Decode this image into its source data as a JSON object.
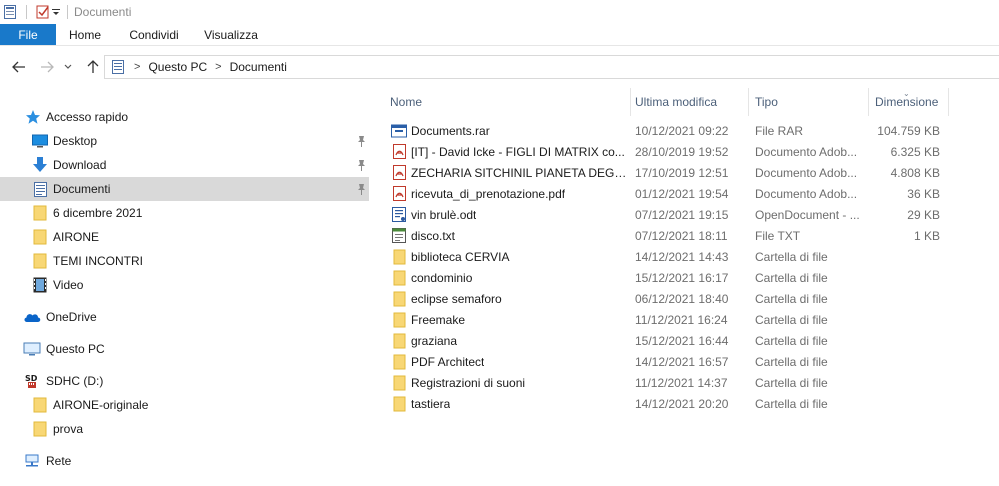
{
  "window": {
    "title": "Documenti"
  },
  "ribbon": {
    "tabs": [
      "File",
      "Home",
      "Condividi",
      "Visualizza"
    ]
  },
  "address": {
    "crumbs": [
      "Questo PC",
      "Documenti"
    ]
  },
  "sidebar": {
    "items": [
      {
        "label": "Accesso rapido",
        "icon": "star-icon",
        "indent": 1
      },
      {
        "label": "Desktop",
        "icon": "desktop-icon",
        "indent": 2,
        "pinned": true
      },
      {
        "label": "Download",
        "icon": "download-icon",
        "indent": 2,
        "pinned": true
      },
      {
        "label": "Documenti",
        "icon": "documents-icon",
        "indent": 2,
        "pinned": true,
        "selected": true
      },
      {
        "label": "6 dicembre 2021",
        "icon": "folder-icon",
        "indent": 2
      },
      {
        "label": "AIRONE",
        "icon": "folder-icon",
        "indent": 2
      },
      {
        "label": "TEMI INCONTRI",
        "icon": "folder-icon",
        "indent": 2
      },
      {
        "label": "Video",
        "icon": "video-icon",
        "indent": 2
      },
      {
        "label": "OneDrive",
        "icon": "cloud-icon",
        "indent": 1
      },
      {
        "label": "Questo PC",
        "icon": "computer-icon",
        "indent": 1
      },
      {
        "label": "SDHC (D:)",
        "icon": "sd-card-icon",
        "indent": 1
      },
      {
        "label": "AIRONE-originale",
        "icon": "folder-icon",
        "indent": 2
      },
      {
        "label": "prova",
        "icon": "folder-icon",
        "indent": 2
      },
      {
        "label": "Rete",
        "icon": "network-icon",
        "indent": 1
      }
    ]
  },
  "filelist": {
    "columns": {
      "name": "Nome",
      "date": "Ultima modifica",
      "type": "Tipo",
      "size": "Dimensione"
    },
    "rows": [
      {
        "name": "Documents.rar",
        "date": "10/12/2021 09:22",
        "type": "File RAR",
        "size": "104.759 KB",
        "icon": "archive-icon"
      },
      {
        "name": "[IT] - David Icke - FIGLI DI MATRIX co...",
        "date": "28/10/2019 19:52",
        "type": "Documento Adob...",
        "size": "6.325 KB",
        "icon": "pdf-icon"
      },
      {
        "name": "ZECHARIA SITCHINIL PIANETA DEGLI ...",
        "date": "17/10/2019 12:51",
        "type": "Documento Adob...",
        "size": "4.808 KB",
        "icon": "pdf-icon"
      },
      {
        "name": "ricevuta_di_prenotazione.pdf",
        "date": "01/12/2021 19:54",
        "type": "Documento Adob...",
        "size": "36 KB",
        "icon": "pdf-icon"
      },
      {
        "name": "vin brulè.odt",
        "date": "07/12/2021 19:15",
        "type": "OpenDocument - ...",
        "size": "29 KB",
        "icon": "odt-icon"
      },
      {
        "name": "disco.txt",
        "date": "07/12/2021 18:11",
        "type": "File TXT",
        "size": "1 KB",
        "icon": "text-file-icon"
      },
      {
        "name": "biblioteca CERVIA",
        "date": "14/12/2021 14:43",
        "type": "Cartella di file",
        "size": "",
        "icon": "folder-icon"
      },
      {
        "name": "condominio",
        "date": "15/12/2021 16:17",
        "type": "Cartella di file",
        "size": "",
        "icon": "folder-icon"
      },
      {
        "name": "eclipse semaforo",
        "date": "06/12/2021 18:40",
        "type": "Cartella di file",
        "size": "",
        "icon": "folder-icon"
      },
      {
        "name": "Freemake",
        "date": "11/12/2021 16:24",
        "type": "Cartella di file",
        "size": "",
        "icon": "folder-icon"
      },
      {
        "name": "graziana",
        "date": "15/12/2021 16:44",
        "type": "Cartella di file",
        "size": "",
        "icon": "folder-icon"
      },
      {
        "name": "PDF Architect",
        "date": "14/12/2021 16:57",
        "type": "Cartella di file",
        "size": "",
        "icon": "folder-icon"
      },
      {
        "name": "Registrazioni di suoni",
        "date": "11/12/2021 14:37",
        "type": "Cartella di file",
        "size": "",
        "icon": "folder-icon"
      },
      {
        "name": "tastiera",
        "date": "14/12/2021 20:20",
        "type": "Cartella di file",
        "size": "",
        "icon": "folder-icon"
      }
    ]
  },
  "colors": {
    "accent": "#1979ca",
    "selection": "#d9d9d9",
    "header_text": "#4c607a",
    "folder": "#f8d775"
  }
}
